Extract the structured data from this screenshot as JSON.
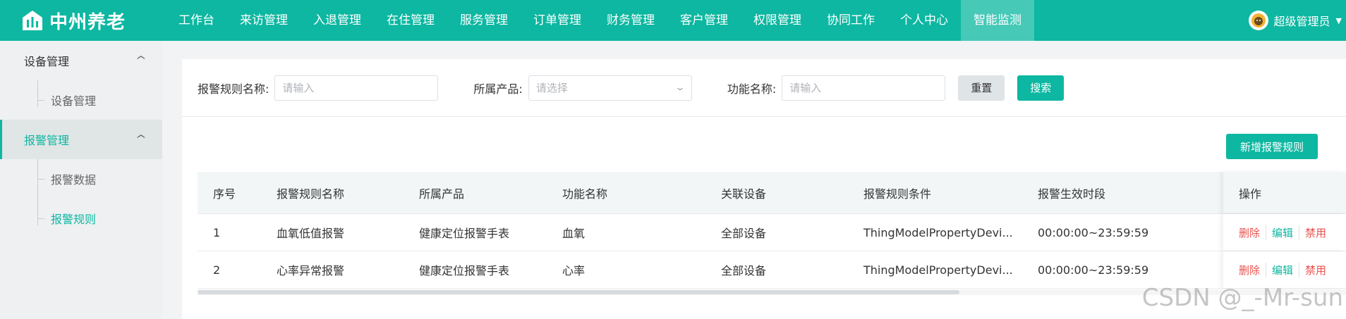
{
  "app": {
    "logo_text": "中州养老"
  },
  "nav": {
    "items": [
      {
        "label": "工作台"
      },
      {
        "label": "来访管理"
      },
      {
        "label": "入退管理"
      },
      {
        "label": "在住管理"
      },
      {
        "label": "服务管理"
      },
      {
        "label": "订单管理"
      },
      {
        "label": "财务管理"
      },
      {
        "label": "客户管理"
      },
      {
        "label": "权限管理"
      },
      {
        "label": "协同工作"
      },
      {
        "label": "个人中心"
      },
      {
        "label": "智能监测",
        "active": true
      }
    ],
    "user_name": "超级管理员"
  },
  "sidebar": {
    "groups": [
      {
        "label": "设备管理",
        "items": [
          {
            "label": "设备管理"
          }
        ]
      },
      {
        "label": "报警管理",
        "active": true,
        "items": [
          {
            "label": "报警数据"
          },
          {
            "label": "报警规则",
            "active": true
          }
        ]
      }
    ]
  },
  "search": {
    "rule_name_label": "报警规则名称:",
    "rule_name_placeholder": "请输入",
    "product_label": "所属产品:",
    "product_placeholder": "请选择",
    "function_label": "功能名称:",
    "function_placeholder": "请输入",
    "reset_label": "重置",
    "search_label": "搜索"
  },
  "add_button_label": "新增报警规则",
  "table": {
    "headers": [
      "序号",
      "报警规则名称",
      "所属产品",
      "功能名称",
      "关联设备",
      "报警规则条件",
      "报警生效时段",
      "操作"
    ],
    "rows": [
      [
        "1",
        "血氧低值报警",
        "健康定位报警手表",
        "血氧",
        "全部设备",
        "ThingModelPropertyDevi...",
        "00:00:00~23:59:59"
      ],
      [
        "2",
        "心率异常报警",
        "健康定位报警手表",
        "心率",
        "全部设备",
        "ThingModelPropertyDevi...",
        "00:00:00~23:59:59"
      ]
    ],
    "actions": {
      "delete": "删除",
      "edit": "编辑",
      "disable": "禁用"
    }
  },
  "watermark": "CSDN @_-Mr-sun",
  "colors": {
    "primary": "#0db7a1",
    "danger": "#e8524f"
  }
}
